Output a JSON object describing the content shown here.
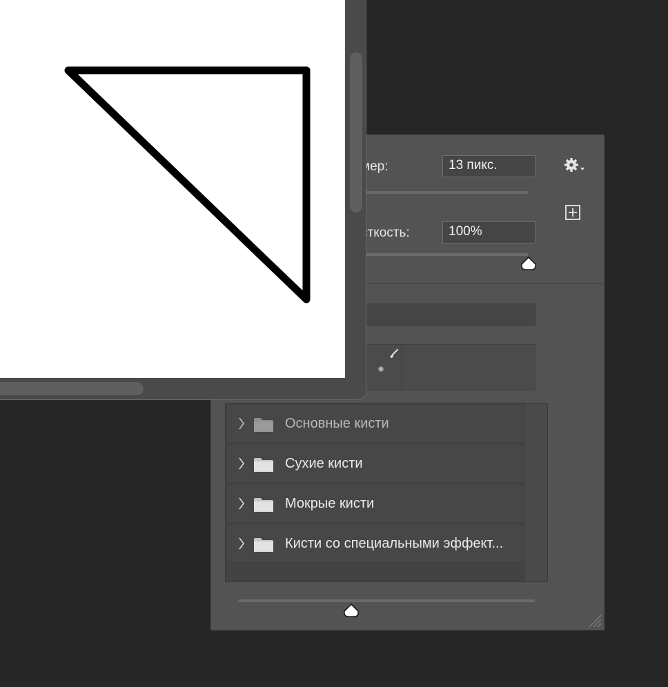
{
  "brush_panel": {
    "size_label": "мер:",
    "size_value": "13 пикс.",
    "hardness_label": "сткость:",
    "hardness_value": "100%",
    "settings_icon": "gear-icon",
    "new_preset_icon": "plus-square-icon",
    "groups": [
      {
        "name": "Основные кисти",
        "icon": "folder-icon"
      },
      {
        "name": "Сухие кисти",
        "icon": "folder-icon"
      },
      {
        "name": "Мокрые кисти",
        "icon": "folder-icon"
      },
      {
        "name": "Кисти со специальными эффект...",
        "icon": "folder-icon"
      }
    ],
    "colors": {
      "panel": "#535353",
      "field": "#454545",
      "list": "#434343"
    }
  },
  "document": {
    "canvas_color": "#ffffff",
    "stroke_color": "#000000"
  }
}
